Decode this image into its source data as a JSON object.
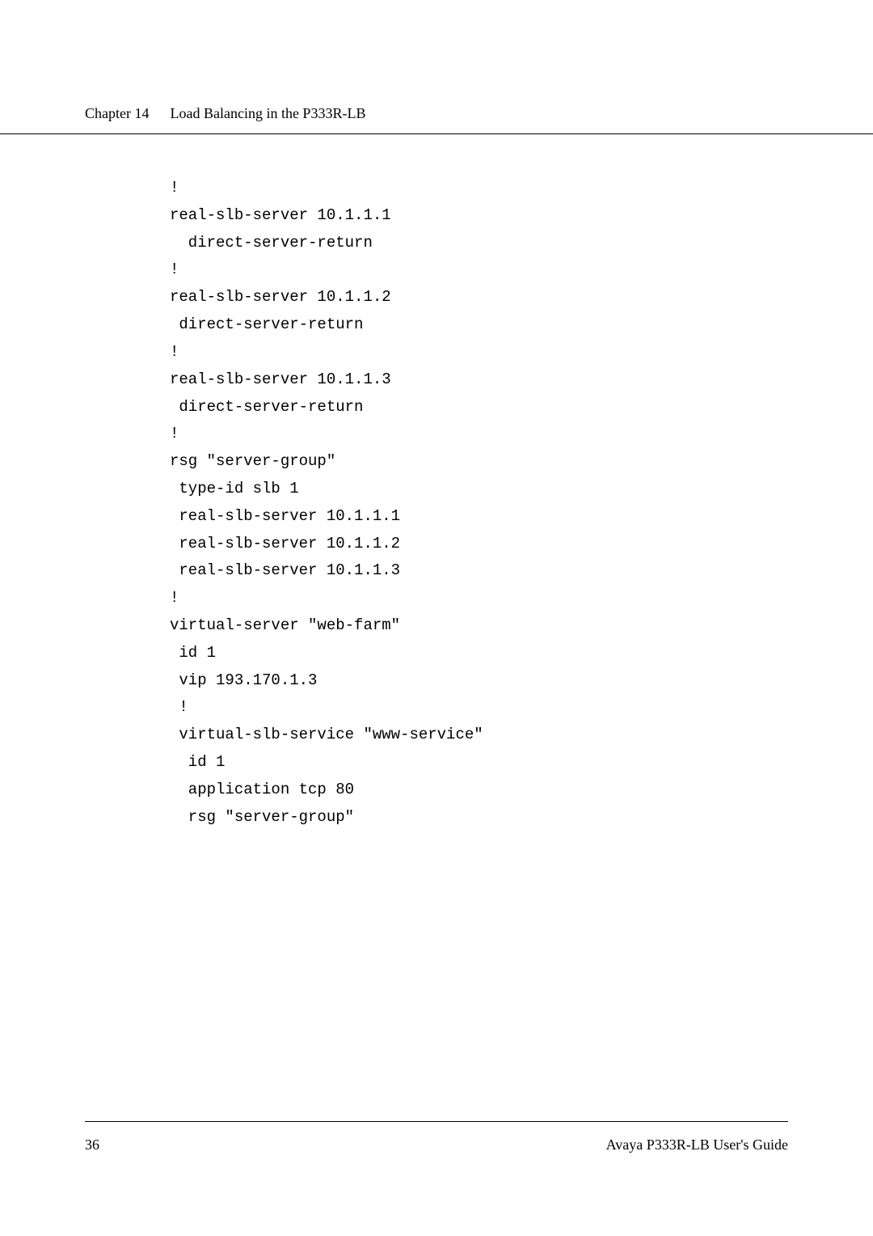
{
  "header": {
    "chapter_label": "Chapter 14",
    "chapter_title": "Load Balancing in the P333R-LB"
  },
  "code": {
    "lines": [
      {
        "text": "!",
        "indent": 0
      },
      {
        "text": "real-slb-server 10.1.1.1",
        "indent": 0
      },
      {
        "text": "  direct-server-return",
        "indent": 0
      },
      {
        "text": "!",
        "indent": 0
      },
      {
        "text": "real-slb-server 10.1.1.2",
        "indent": 0
      },
      {
        "text": " direct-server-return",
        "indent": 0
      },
      {
        "text": "!",
        "indent": 0
      },
      {
        "text": "real-slb-server 10.1.1.3",
        "indent": 0
      },
      {
        "text": " direct-server-return",
        "indent": 0
      },
      {
        "text": "!",
        "indent": 0
      },
      {
        "text": "rsg \"server-group\"",
        "indent": 0
      },
      {
        "text": " type-id slb 1",
        "indent": 0
      },
      {
        "text": " real-slb-server 10.1.1.1",
        "indent": 0
      },
      {
        "text": " real-slb-server 10.1.1.2",
        "indent": 0
      },
      {
        "text": " real-slb-server 10.1.1.3",
        "indent": 0
      },
      {
        "text": "!",
        "indent": 0
      },
      {
        "text": "virtual-server \"web-farm\"",
        "indent": 0
      },
      {
        "text": " id 1",
        "indent": 0
      },
      {
        "text": " vip 193.170.1.3",
        "indent": 0
      },
      {
        "text": " !",
        "indent": 0
      },
      {
        "text": " virtual-slb-service \"www-service\"",
        "indent": 0
      },
      {
        "text": "  id 1",
        "indent": 0
      },
      {
        "text": "  application tcp 80",
        "indent": 0
      },
      {
        "text": "  rsg \"server-group\"",
        "indent": 0
      }
    ]
  },
  "footer": {
    "page_number": "36",
    "doc_title": "Avaya P333R-LB User's Guide"
  }
}
